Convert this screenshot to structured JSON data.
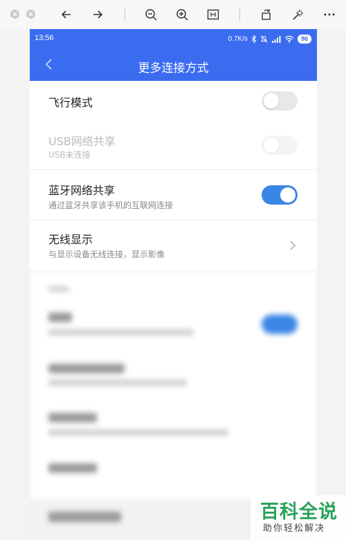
{
  "status_bar": {
    "time": "13:56",
    "network_speed": "0.7K/s",
    "battery": "96"
  },
  "header": {
    "title": "更多连接方式"
  },
  "settings": {
    "airplane": {
      "title": "飞行模式",
      "enabled": false
    },
    "usb_tethering": {
      "title": "USB网络共享",
      "subtitle": "USB未连接",
      "enabled": false,
      "disabled": true
    },
    "bt_tethering": {
      "title": "蓝牙网络共享",
      "subtitle": "通过蓝牙共享该手机的互联网连接",
      "enabled": true
    },
    "wireless_display": {
      "title": "无线显示",
      "subtitle": "与显示设备无线连接，显示影像"
    }
  },
  "watermark": {
    "title": "百科全说",
    "subtitle": "助你轻松解决"
  },
  "colors": {
    "accent": "#3b6cf0",
    "toggle_on": "#3a86e6",
    "watermark_green": "#2aa35a"
  },
  "icons": {
    "toolbar": [
      "close-icon",
      "close-icon",
      "arrow-left-icon",
      "arrow-right-icon",
      "zoom-out-icon",
      "zoom-in-icon",
      "fit-icon",
      "rotate-icon",
      "magic-wand-icon",
      "more-icon"
    ],
    "status": [
      "bluetooth-icon",
      "mute-icon",
      "signal-icon",
      "wifi-icon",
      "battery-icon"
    ]
  }
}
